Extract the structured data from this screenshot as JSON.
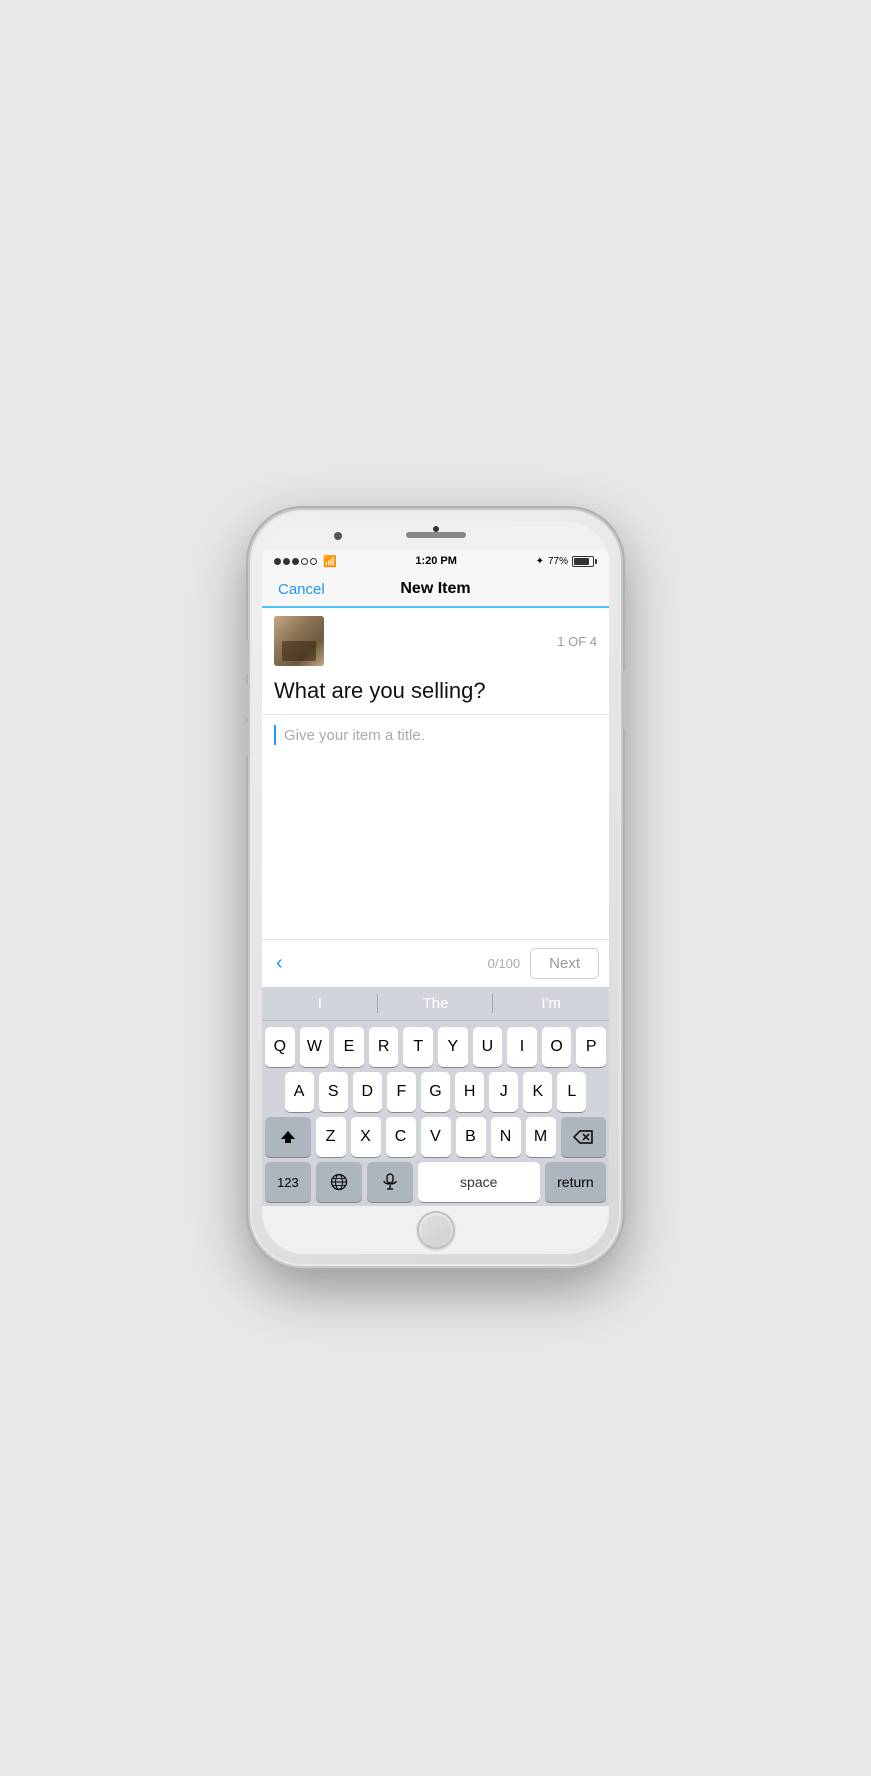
{
  "status_bar": {
    "time": "1:20 PM",
    "battery": "77%",
    "signal_dots": [
      "filled",
      "filled",
      "filled",
      "empty",
      "empty"
    ]
  },
  "nav": {
    "cancel_label": "Cancel",
    "title": "New Item"
  },
  "step": {
    "counter": "1 OF 4",
    "question": "What are you selling?",
    "placeholder": "Give your item a title.",
    "char_count": "0/100",
    "next_label": "Next"
  },
  "predictive": {
    "items": [
      "I",
      "The",
      "I'm"
    ]
  },
  "keyboard": {
    "row1": [
      "Q",
      "W",
      "E",
      "R",
      "T",
      "Y",
      "U",
      "I",
      "O",
      "P"
    ],
    "row2": [
      "A",
      "S",
      "D",
      "F",
      "G",
      "H",
      "J",
      "K",
      "L"
    ],
    "row3": [
      "Z",
      "X",
      "C",
      "V",
      "B",
      "N",
      "M"
    ],
    "bottom": {
      "nums": "123",
      "space": "space",
      "return": "return"
    }
  }
}
